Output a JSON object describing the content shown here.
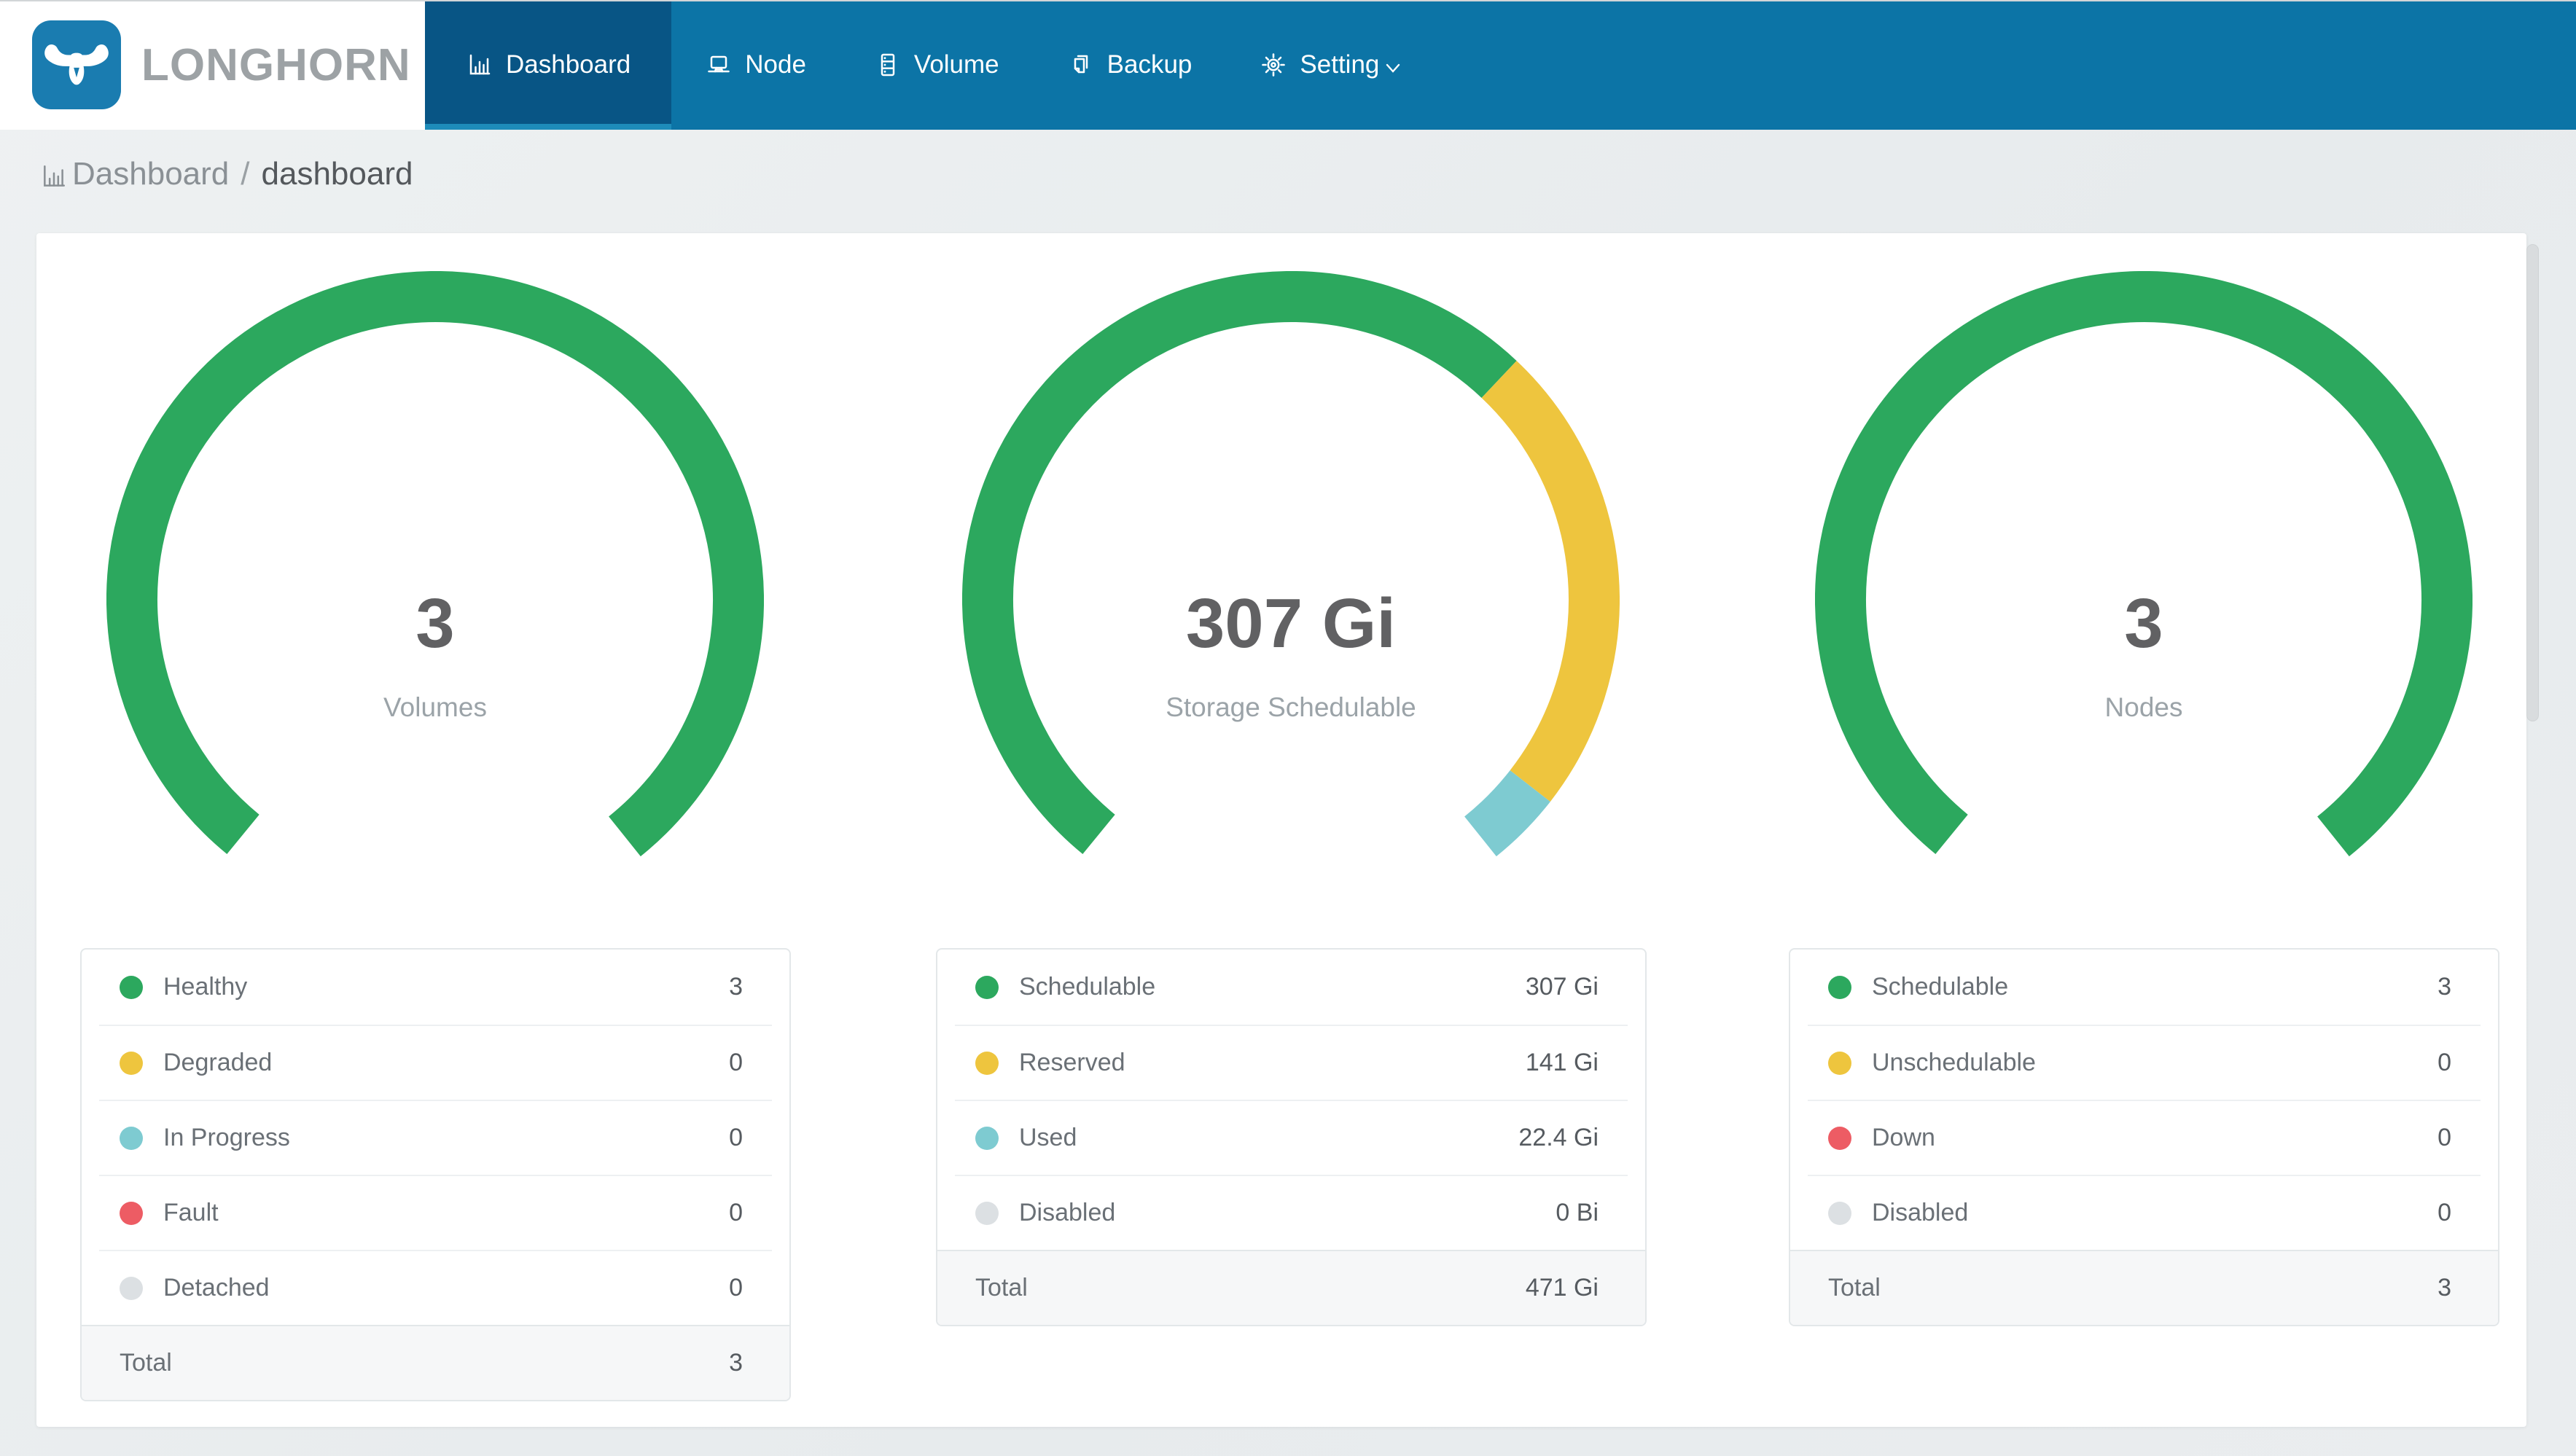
{
  "brand": {
    "title": "LONGHORN",
    "logo_color": "#1a7cb0"
  },
  "nav": {
    "bg": "#0c74a6",
    "active_bg": "#085585",
    "active_strip": "#1e8cba",
    "items": [
      {
        "label": "Dashboard",
        "icon": "bar-chart-icon",
        "active": true
      },
      {
        "label": "Node",
        "icon": "laptop-icon",
        "active": false
      },
      {
        "label": "Volume",
        "icon": "server-icon",
        "active": false
      },
      {
        "label": "Backup",
        "icon": "copy-icon",
        "active": false
      },
      {
        "label": "Setting",
        "icon": "gear-icon",
        "active": false,
        "has_dropdown": true
      }
    ]
  },
  "breadcrumb": {
    "section": "Dashboard",
    "separator": "/",
    "page": "dashboard"
  },
  "colors": {
    "green": "#2ca85e",
    "yellow": "#eec53e",
    "teal": "#7ecbd1",
    "red": "#ed5c64",
    "gray": "#dce0e3"
  },
  "chart_data": [
    {
      "type": "donut",
      "center_value": "3",
      "center_label": "Volumes",
      "arc_degrees": 282,
      "gap_position": "bottom",
      "segments": [
        {
          "label": "Healthy",
          "value": 3,
          "display": "3",
          "color": "#2ca85e"
        },
        {
          "label": "Degraded",
          "value": 0,
          "display": "0",
          "color": "#eec53e"
        },
        {
          "label": "In Progress",
          "value": 0,
          "display": "0",
          "color": "#7ecbd1"
        },
        {
          "label": "Fault",
          "value": 0,
          "display": "0",
          "color": "#ed5c64"
        },
        {
          "label": "Detached",
          "value": 0,
          "display": "0",
          "color": "#dce0e3"
        }
      ],
      "total": {
        "label": "Total",
        "display": "3"
      }
    },
    {
      "type": "donut",
      "center_value": "307 Gi",
      "center_label": "Storage Schedulable",
      "arc_degrees": 282,
      "gap_position": "bottom",
      "segments": [
        {
          "label": "Schedulable",
          "value": 307,
          "display": "307 Gi",
          "color": "#2ca85e"
        },
        {
          "label": "Reserved",
          "value": 141,
          "display": "141 Gi",
          "color": "#eec53e"
        },
        {
          "label": "Used",
          "value": 22.4,
          "display": "22.4 Gi",
          "color": "#7ecbd1"
        },
        {
          "label": "Disabled",
          "value": 0,
          "display": "0 Bi",
          "color": "#dce0e3"
        }
      ],
      "total": {
        "label": "Total",
        "display": "471 Gi"
      }
    },
    {
      "type": "donut",
      "center_value": "3",
      "center_label": "Nodes",
      "arc_degrees": 282,
      "gap_position": "bottom",
      "segments": [
        {
          "label": "Schedulable",
          "value": 3,
          "display": "3",
          "color": "#2ca85e"
        },
        {
          "label": "Unschedulable",
          "value": 0,
          "display": "0",
          "color": "#eec53e"
        },
        {
          "label": "Down",
          "value": 0,
          "display": "0",
          "color": "#ed5c64"
        },
        {
          "label": "Disabled",
          "value": 0,
          "display": "0",
          "color": "#dce0e3"
        }
      ],
      "total": {
        "label": "Total",
        "display": "3"
      }
    }
  ]
}
